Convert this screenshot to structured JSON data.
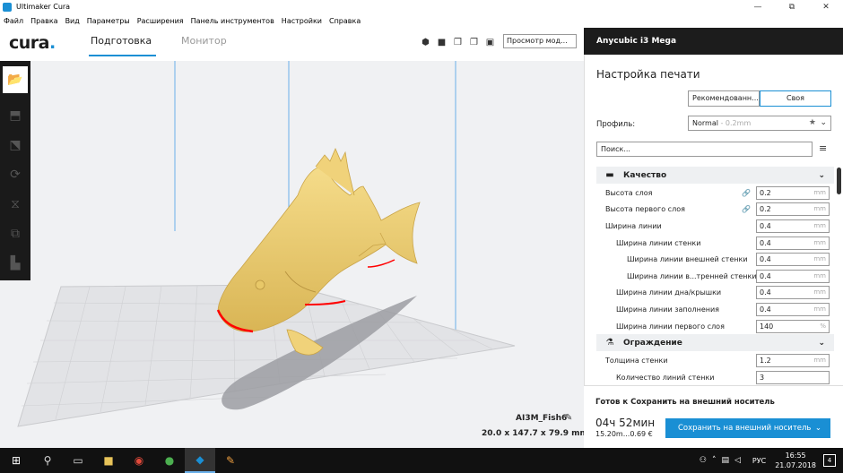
{
  "window": {
    "title": "Ultimaker Cura",
    "controls": [
      "—",
      "⧉",
      "✕"
    ]
  },
  "menu": [
    "Файл",
    "Правка",
    "Вид",
    "Параметры",
    "Расширения",
    "Панель инструментов",
    "Настройки",
    "Справка"
  ],
  "header": {
    "logo": "cura",
    "logo_dot": ".",
    "tab_prepare": "Подготовка",
    "tab_monitor": "Монитор",
    "view_select": "Просмотр мод..."
  },
  "viewport": {
    "model_name": "AI3M_Fish6",
    "model_dims": "20.0 x 147.7 x 79.9 mm"
  },
  "printer": {
    "name": "Anycubic i3 Mega"
  },
  "panel": {
    "title": "Настройка печати",
    "mode_recommended": "Рекомендованн...",
    "mode_custom": "Своя",
    "profile_label": "Профиль:",
    "profile_value": "Normal",
    "profile_sub": " - 0.2mm",
    "search_placeholder": "Поиск..."
  },
  "settings": {
    "quality": {
      "title": "Качество",
      "rows": [
        {
          "label": "Высота слоя",
          "value": "0.2",
          "unit": "mm",
          "indent": 0,
          "linked": true
        },
        {
          "label": "Высота первого слоя",
          "value": "0.2",
          "unit": "mm",
          "indent": 0,
          "linked": true
        },
        {
          "label": "Ширина линии",
          "value": "0.4",
          "unit": "mm",
          "indent": 0,
          "linked": false
        },
        {
          "label": "Ширина линии стенки",
          "value": "0.4",
          "unit": "mm",
          "indent": 1,
          "linked": false
        },
        {
          "label": "Ширина линии внешней стенки",
          "value": "0.4",
          "unit": "mm",
          "indent": 2,
          "linked": false
        },
        {
          "label": "Ширина линии в...тренней стенки",
          "value": "0.4",
          "unit": "mm",
          "indent": 2,
          "linked": false
        },
        {
          "label": "Ширина линии дна/крышки",
          "value": "0.4",
          "unit": "mm",
          "indent": 1,
          "linked": false
        },
        {
          "label": "Ширина линии заполнения",
          "value": "0.4",
          "unit": "mm",
          "indent": 1,
          "linked": false
        },
        {
          "label": "Ширина линии первого слоя",
          "value": "140",
          "unit": "%",
          "indent": 1,
          "linked": false
        }
      ]
    },
    "shell": {
      "title": "Ограждение",
      "rows": [
        {
          "label": "Толщина стенки",
          "value": "1.2",
          "unit": "mm",
          "indent": 0,
          "linked": false
        },
        {
          "label": "Количество линий стенки",
          "value": "3",
          "unit": "",
          "indent": 1,
          "linked": false
        }
      ]
    }
  },
  "footer": {
    "ready": "Готов к Сохранить на внешний носитель",
    "time": "04ч 52мин",
    "material": "15.20m...0.69 €",
    "save_button": "Сохранить на внешний носитель"
  },
  "taskbar": {
    "lang": "РУС",
    "time": "16:55",
    "date": "21.07.2018",
    "notifications": "4"
  },
  "colors": {
    "accent": "#1a8fd4",
    "model": "#f0d27a",
    "overhang": "#ff0000",
    "dark": "#1c1c1c"
  }
}
